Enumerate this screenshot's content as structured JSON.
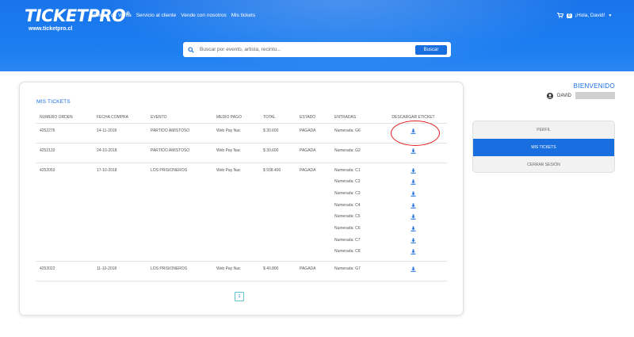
{
  "header": {
    "logo": "TICKETPRO",
    "logo_mark": "®",
    "logo_url": "www.ticketpro.cl",
    "nav": [
      "Puntos de Venta",
      "Servicio al cliente",
      "Vende con nosotros",
      "Mis tickets"
    ],
    "cart_count": "0",
    "greeting": "¡Hola, David!",
    "search_placeholder": "Buscar por evento, artista, recinto...",
    "search_button": "Buscar"
  },
  "orders": {
    "title": "MIS TICKETS",
    "columns": [
      "NUMERO ORDEN",
      "FECHA COMPRA",
      "EVENTO",
      "MEDIO PAGO",
      "TOTAL",
      "ESTADO",
      "ENTRADAS",
      "DESCARGAR ETICKET"
    ],
    "rows": [
      {
        "orden": "4252276",
        "fecha": "14-11-2018",
        "evento": "PARTIDO AMISTOSO",
        "medio": "Web Pay Nac",
        "total": "$ 30.600",
        "estado": "PAGADA",
        "entradas": [
          "Numerada: G6"
        ]
      },
      {
        "orden": "4252133",
        "fecha": "24-10-2018",
        "evento": "PARTIDO AMISTOSO",
        "medio": "Web Pay Nac",
        "total": "$ 30.600",
        "estado": "PAGADA",
        "entradas": [
          "Numerada: G2"
        ]
      },
      {
        "orden": "4252053",
        "fecha": "17-10-2018",
        "evento": "LOS PRISIONEROS",
        "medio": "Web Pay Nac",
        "total": "$ 938.400",
        "estado": "PAGADA",
        "entradas": [
          "Numerada: C1",
          "Numerada: C2",
          "Numerada: C3",
          "Numerada: C4",
          "Numerada: C5",
          "Numerada: C6",
          "Numerada: C7",
          "Numerada: C8"
        ]
      },
      {
        "orden": "4252022",
        "fecha": "11-10-2018",
        "evento": "LOS PRISIONEROS",
        "medio": "Web Pay Nac",
        "total": "$ 40.800",
        "estado": "PAGADA",
        "entradas": [
          "Numerada: G7"
        ]
      }
    ],
    "page": "1"
  },
  "sidebar": {
    "welcome": "BIENVENIDO",
    "username": "DAVID",
    "menu": [
      {
        "label": "PERFIL",
        "active": false
      },
      {
        "label": "MIS TICKETS",
        "active": true
      },
      {
        "label": "CERRAR SESIÓN",
        "active": false
      }
    ]
  },
  "colors": {
    "brand": "#1a6fe0",
    "highlight_circle": "#e02020"
  },
  "icons": {
    "download": "download-icon",
    "search": "search-icon",
    "cart": "cart-icon",
    "user": "user-icon"
  }
}
